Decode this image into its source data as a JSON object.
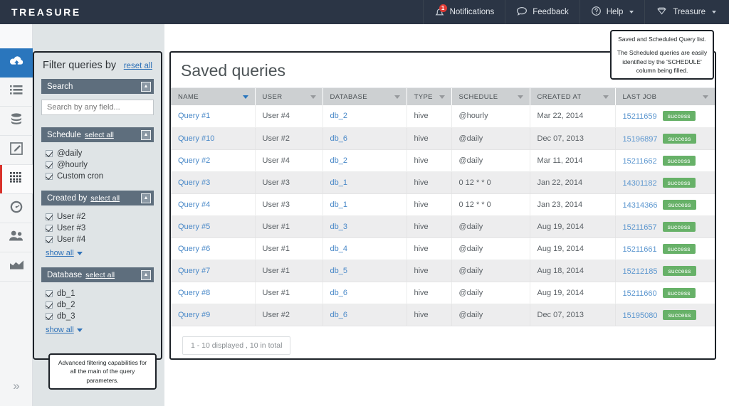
{
  "topbar": {
    "brand": "TREASURE",
    "nav": [
      {
        "label": "Notifications",
        "icon": "bell-icon",
        "badge": "1"
      },
      {
        "label": "Feedback",
        "icon": "chat-bubble-icon"
      },
      {
        "label": "Help",
        "icon": "question-circle-icon",
        "caret": true
      },
      {
        "label": "Treasure",
        "icon": "diamond-icon",
        "caret": true
      }
    ]
  },
  "rail": {
    "items": [
      {
        "name": "upload",
        "icon": "cloud-upload-icon",
        "state": "active-blue"
      },
      {
        "name": "jobs",
        "icon": "list-icon",
        "state": ""
      },
      {
        "name": "databases",
        "icon": "database-icon",
        "state": ""
      },
      {
        "name": "new-query",
        "icon": "edit-pencil-icon",
        "state": ""
      },
      {
        "name": "saved-queries",
        "icon": "grid-icon",
        "state": "selected"
      },
      {
        "name": "scheduler",
        "icon": "gauge-icon",
        "state": ""
      },
      {
        "name": "users",
        "icon": "users-icon",
        "state": ""
      },
      {
        "name": "analytics",
        "icon": "chart-icon",
        "state": ""
      }
    ],
    "expand_icon": "chevron-double-right-icon"
  },
  "filters": {
    "title": "Filter queries by",
    "reset_label": "reset all",
    "search": {
      "header": "Search",
      "placeholder": "Search by any field...",
      "value": ""
    },
    "sections": [
      {
        "header": "Schedule",
        "select_all": "select all",
        "options": [
          {
            "label": "@daily",
            "checked": true
          },
          {
            "label": "@hourly",
            "checked": true
          },
          {
            "label": "Custom cron",
            "checked": true
          }
        ],
        "show_all": null
      },
      {
        "header": "Created by",
        "select_all": "select all",
        "options": [
          {
            "label": "User #2",
            "checked": true
          },
          {
            "label": "User #3",
            "checked": true
          },
          {
            "label": "User #4",
            "checked": true
          }
        ],
        "show_all": "show all"
      },
      {
        "header": "Database",
        "select_all": "select all",
        "options": [
          {
            "label": "db_1",
            "checked": true
          },
          {
            "label": "db_2",
            "checked": true
          },
          {
            "label": "db_3",
            "checked": true
          }
        ],
        "show_all": "show all"
      }
    ]
  },
  "tooltips": {
    "filters": "Advanced filtering capabilities for all the main of the query parameters.",
    "saved_line1": "Saved and Scheduled Query list.",
    "saved_line2": "The Scheduled queries are easily identified by the 'SCHEDULE' column being filled."
  },
  "main": {
    "title": "Saved queries",
    "columns": [
      {
        "label": "NAME",
        "sorted": true
      },
      {
        "label": "USER",
        "sorted": false
      },
      {
        "label": "DATABASE",
        "sorted": false
      },
      {
        "label": "TYPE",
        "sorted": false
      },
      {
        "label": "SCHEDULE",
        "sorted": false
      },
      {
        "label": "CREATED AT",
        "sorted": false
      },
      {
        "label": "LAST JOB",
        "sorted": false
      }
    ],
    "rows": [
      {
        "name": "Query #1",
        "user": "User #4",
        "database": "db_2",
        "type": "hive",
        "schedule": "@hourly",
        "created_at": "Mar 22, 2014",
        "job_id": "15211659",
        "status": "success"
      },
      {
        "name": "Query #10",
        "user": "User #2",
        "database": "db_6",
        "type": "hive",
        "schedule": "@daily",
        "created_at": "Dec 07, 2013",
        "job_id": "15196897",
        "status": "success"
      },
      {
        "name": "Query #2",
        "user": "User #4",
        "database": "db_2",
        "type": "hive",
        "schedule": "@daily",
        "created_at": "Mar 11, 2014",
        "job_id": "15211662",
        "status": "success"
      },
      {
        "name": "Query #3",
        "user": "User #3",
        "database": "db_1",
        "type": "hive",
        "schedule": "0 12 * * 0",
        "created_at": "Jan 22, 2014",
        "job_id": "14301182",
        "status": "success"
      },
      {
        "name": "Query #4",
        "user": "User #3",
        "database": "db_1",
        "type": "hive",
        "schedule": "0 12 * * 0",
        "created_at": "Jan 23, 2014",
        "job_id": "14314366",
        "status": "success"
      },
      {
        "name": "Query #5",
        "user": "User #1",
        "database": "db_3",
        "type": "hive",
        "schedule": "@daily",
        "created_at": "Aug 19, 2014",
        "job_id": "15211657",
        "status": "success"
      },
      {
        "name": "Query #6",
        "user": "User #1",
        "database": "db_4",
        "type": "hive",
        "schedule": "@daily",
        "created_at": "Aug 19, 2014",
        "job_id": "15211661",
        "status": "success"
      },
      {
        "name": "Query #7",
        "user": "User #1",
        "database": "db_5",
        "type": "hive",
        "schedule": "@daily",
        "created_at": "Aug 18, 2014",
        "job_id": "15212185",
        "status": "success"
      },
      {
        "name": "Query #8",
        "user": "User #1",
        "database": "db_6",
        "type": "hive",
        "schedule": "@daily",
        "created_at": "Aug 19, 2014",
        "job_id": "15211660",
        "status": "success"
      },
      {
        "name": "Query #9",
        "user": "User #2",
        "database": "db_6",
        "type": "hive",
        "schedule": "@daily",
        "created_at": "Dec 07, 2013",
        "job_id": "15195080",
        "status": "success"
      }
    ],
    "pager_label": "1 - 10 displayed , 10 in total"
  },
  "colors": {
    "topbar": "#2b3545",
    "accent_blue": "#2a76bd",
    "link_blue": "#4a89c8",
    "status_green": "#67b168",
    "badge_red": "#e03b35",
    "section_header": "#5e6e7d",
    "selected_marker": "#d9322b"
  }
}
